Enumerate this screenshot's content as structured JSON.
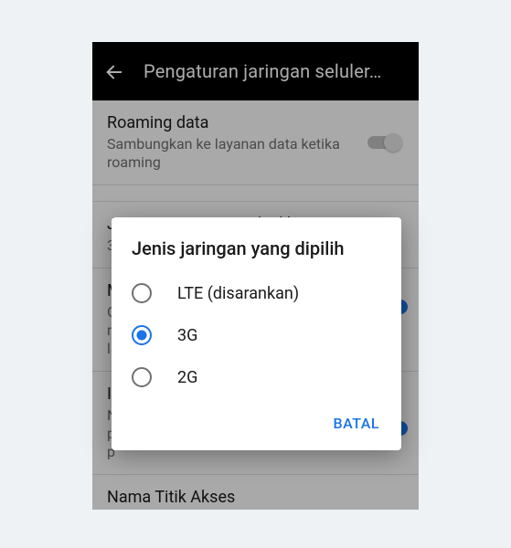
{
  "header": {
    "title": "Pengaturan jaringan seluler…"
  },
  "rows": {
    "roaming": {
      "title": "Roaming data",
      "sub": "Sambungkan ke layanan data ketika roaming"
    },
    "network_type": {
      "title": "Jenis jaringan yang dipilih",
      "sub": "3"
    },
    "m_row": {
      "title": "M",
      "sub_line1": "G",
      "sub_line2": "m",
      "sub_line3": "la"
    },
    "i_row": {
      "title": "I",
      "sub_line1": "N",
      "sub_line2": "p",
      "sub_line3": "p"
    },
    "apn": {
      "title": "Nama Titik Akses"
    }
  },
  "dialog": {
    "title": "Jenis jaringan yang dipilih",
    "options": [
      {
        "label": "LTE (disarankan)",
        "checked": false
      },
      {
        "label": "3G",
        "checked": true
      },
      {
        "label": "2G",
        "checked": false
      }
    ],
    "cancel": "BATAL"
  }
}
